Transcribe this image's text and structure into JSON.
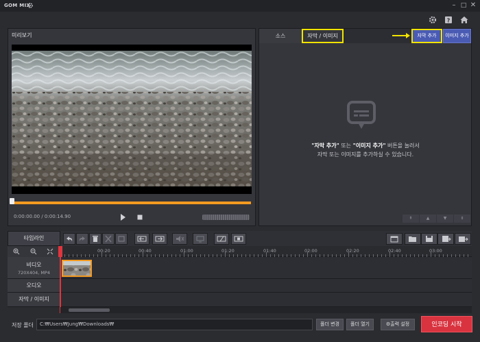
{
  "app": {
    "title": "GOM MIX"
  },
  "window": {
    "minimize": "–",
    "maximize": "□",
    "close": "✕"
  },
  "preview": {
    "title": "미리보기",
    "time": "0:00:00.00 / 0:00:14.90",
    "progress_fraction": 1.0
  },
  "tabs": {
    "source": "소스",
    "subtitle_image": "자막 / 이미지"
  },
  "right_buttons": {
    "add_subtitle": "자막 추가",
    "add_image": "이미지 추가"
  },
  "empty_message": {
    "q1": "\"자막 추가\"",
    "mid1": " 또는 ",
    "q2": "\"이미지 추가\"",
    "rest1": " 버튼을 눌러서",
    "line2": "자막 또는 이미지를 추가하실 수 있습니다."
  },
  "timeline": {
    "label": "타임라인",
    "ruler": [
      "00:20",
      "00:40",
      "01:00",
      "01:20",
      "01:40",
      "02:00",
      "02:20",
      "02:40",
      "03:00"
    ],
    "tracks": {
      "video": "비디오",
      "video_info": "720X404, MP4",
      "audio": "오디오",
      "subtitle": "자막 / 이미지"
    }
  },
  "bottom": {
    "save_folder_label": "저장 폴더",
    "path": "C:₩Users₩Jung₩Downloads₩",
    "change_folder": "폴더 변경",
    "open_folder": "폴더 열기",
    "output_settings": "출력 설정",
    "encode_start": "인코딩 시작"
  },
  "colors": {
    "accent_orange": "#f39a20",
    "highlight_yellow": "#f2e400",
    "button_blue": "#4a5bb4",
    "encode_red": "#d8333f",
    "playhead": "#e0353e"
  }
}
